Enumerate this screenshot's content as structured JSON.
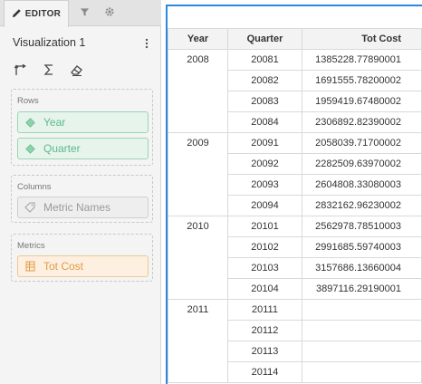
{
  "editor_panel": {
    "tabs": {
      "editor_label": "EDITOR"
    },
    "visualization_title": "Visualization 1",
    "rows_well": {
      "title": "Rows",
      "items": [
        {
          "label": "Year"
        },
        {
          "label": "Quarter"
        }
      ]
    },
    "columns_well": {
      "title": "Columns",
      "items": [
        {
          "label": "Metric Names"
        }
      ]
    },
    "metrics_well": {
      "title": "Metrics",
      "items": [
        {
          "label": "Tot Cost"
        }
      ]
    }
  },
  "colors": {
    "accent_border": "#2a89de",
    "attribute_pill": "#5fb98a",
    "metric_pill": "#e39a45",
    "names_pill": "#9a9a9a"
  },
  "icons": [
    "pencil-icon",
    "filter-icon",
    "gear-icon",
    "more-vertical-icon",
    "swap-axes-icon",
    "sigma-icon",
    "eraser-icon",
    "attribute-diamond-icon",
    "metric-names-tag-icon",
    "metric-table-icon"
  ],
  "grid": {
    "headers": {
      "year": "Year",
      "quarter": "Quarter",
      "metric": "Tot Cost"
    },
    "groups": [
      {
        "year": "2008",
        "rows": [
          {
            "quarter": "20081",
            "value": "1385228.77890001"
          },
          {
            "quarter": "20082",
            "value": "1691555.78200002"
          },
          {
            "quarter": "20083",
            "value": "1959419.67480002"
          },
          {
            "quarter": "20084",
            "value": "2306892.82390002"
          }
        ]
      },
      {
        "year": "2009",
        "rows": [
          {
            "quarter": "20091",
            "value": "2058039.71700002"
          },
          {
            "quarter": "20092",
            "value": "2282509.63970002"
          },
          {
            "quarter": "20093",
            "value": "2604808.33080003"
          },
          {
            "quarter": "20094",
            "value": "2832162.96230002"
          }
        ]
      },
      {
        "year": "2010",
        "rows": [
          {
            "quarter": "20101",
            "value": "2562978.78510003"
          },
          {
            "quarter": "20102",
            "value": "2991685.59740003"
          },
          {
            "quarter": "20103",
            "value": "3157686.13660004"
          },
          {
            "quarter": "20104",
            "value": "3897116.29190001"
          }
        ]
      },
      {
        "year": "2011",
        "rows": [
          {
            "quarter": "20111",
            "value": ""
          },
          {
            "quarter": "20112",
            "value": ""
          },
          {
            "quarter": "20113",
            "value": ""
          },
          {
            "quarter": "20114",
            "value": ""
          }
        ]
      }
    ]
  }
}
